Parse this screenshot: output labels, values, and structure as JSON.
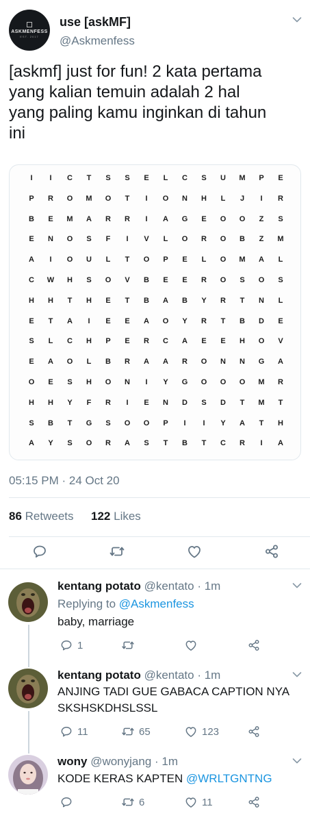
{
  "tweet": {
    "author_name": "use [askMF]",
    "author_handle": "@Askmenfess",
    "avatar_text": "ASKMENFESS",
    "avatar_subtext": "EST. 2017",
    "text_lines": [
      "[askmf] just for fun! 2 kata pertama",
      "yang kalian temuin adalah 2 hal",
      "yang paling kamu inginkan di tahun",
      "ini"
    ],
    "timestamp": "05:15 PM · 24 Oct 20",
    "retweets_count": "86",
    "retweets_label": "Retweets",
    "likes_count": "122",
    "likes_label": "Likes",
    "icons": [
      "reply-icon",
      "retweet-icon",
      "like-icon",
      "share-icon",
      "chevron-down-icon"
    ]
  },
  "puzzle": {
    "rows": [
      "IICTSSELCSUMPE",
      "PROMOTIONHLJIR",
      "BEMARRIAGEOOZS",
      "ENOSFIVLOROBZM",
      "AIOULTOPELOMAL",
      "CWHSOVBEEROSOS",
      "HHTHETBABYRTNL",
      "ETAIEEAOYRTBDE",
      "SLCHPERCAEEHOV",
      "EAOLBRAARONNGA",
      "OESHONIYGOOOMR",
      "HHYFRIENDSDTMT",
      "SBTGSOOPIIYATH",
      "AYSORASTBTCRIA"
    ]
  },
  "replies": [
    {
      "name": "kentang potato",
      "handle": "@kentato",
      "time": "· 1m",
      "replying_prefix": "Replying to",
      "replying_handle": "@Askmenfess",
      "line1": "baby, marriage",
      "line2": "",
      "mention": "",
      "reply_count": "1",
      "retweet_count": "",
      "like_count": ""
    },
    {
      "name": "kentang potato",
      "handle": "@kentato",
      "time": "· 1m",
      "line1": "ANJING TADI GUE GABACA CAPTION NYA",
      "line2": "SKSHSKDHSLSSL",
      "mention": "",
      "reply_count": "11",
      "retweet_count": "65",
      "like_count": "123"
    },
    {
      "name": "wony",
      "handle": "@wonyjang",
      "time": "· 1m",
      "line1": "KODE KERAS KAPTEN ",
      "line2": "",
      "mention": "@WRLTGNTNG",
      "reply_count": "",
      "retweet_count": "6",
      "like_count": "11"
    }
  ],
  "colors": {
    "link": "#1b95e0",
    "muted": "#657786",
    "text": "#14171a",
    "divider": "#e1e8ed"
  }
}
